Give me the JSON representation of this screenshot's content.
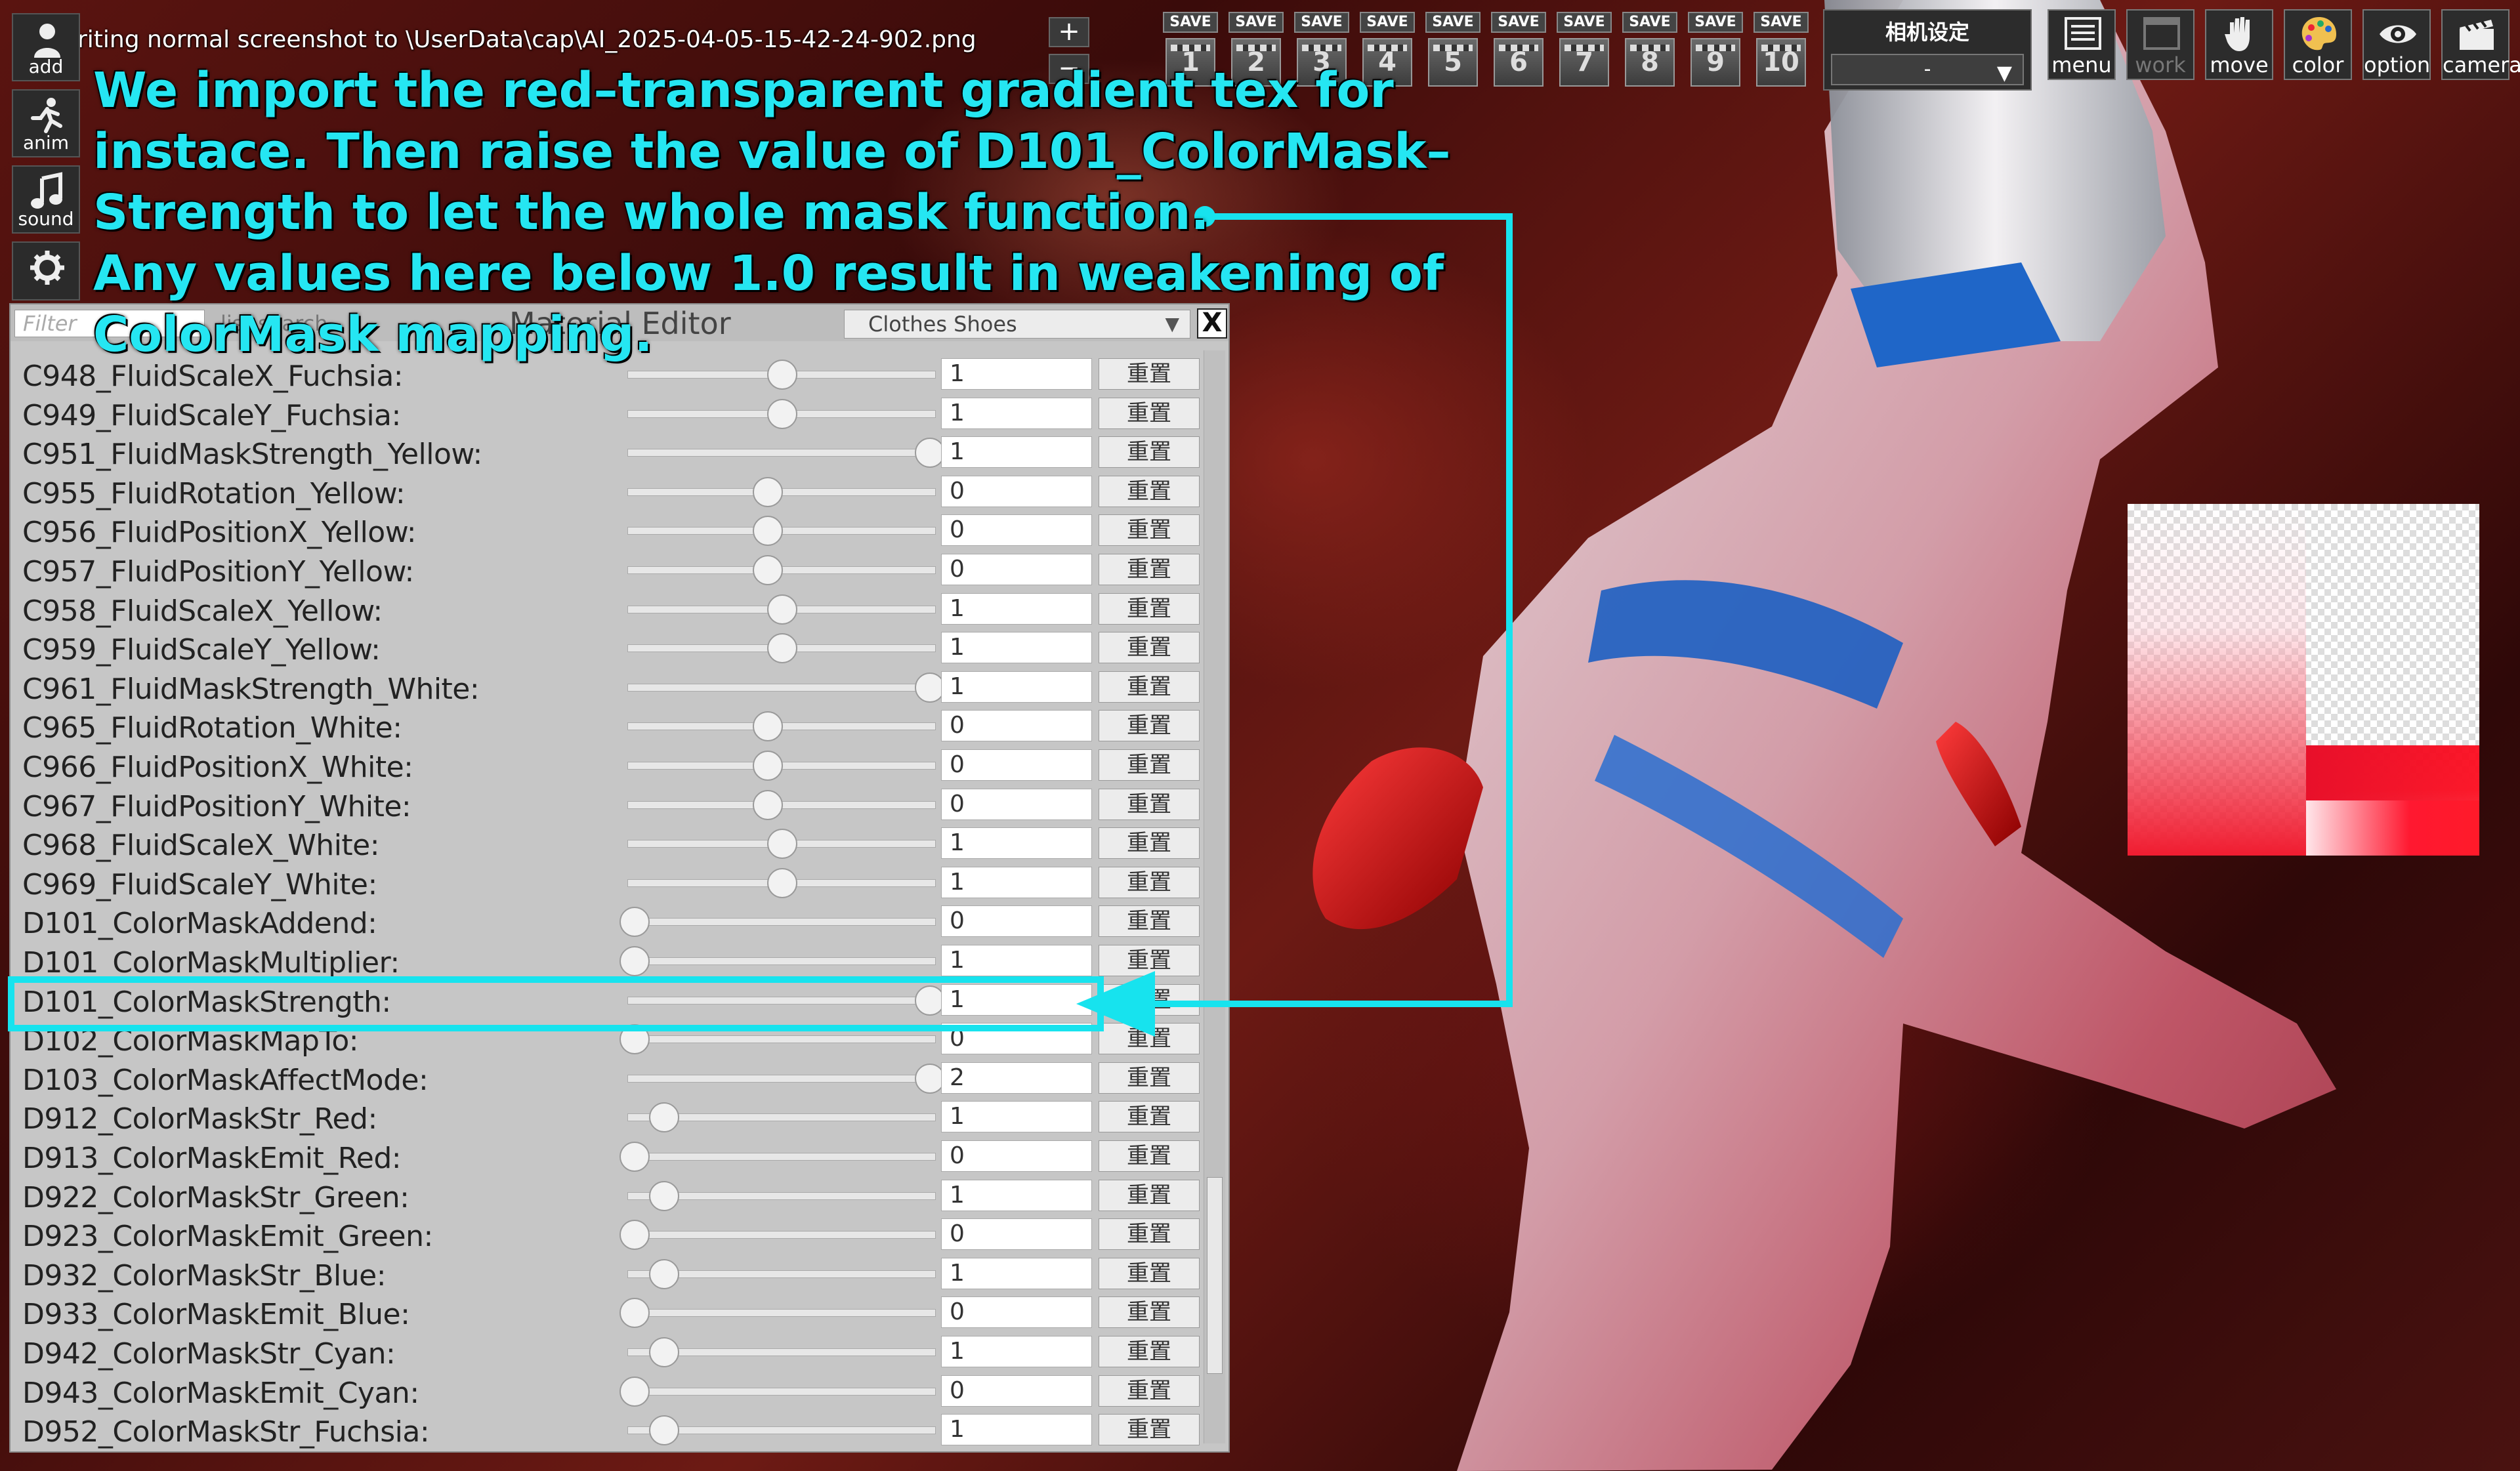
{
  "title_bar": "riting normal screenshot to \\UserData\\cap\\AI_2025-04-05-15-42-24-902.png",
  "side_buttons": [
    {
      "label": "add",
      "icon": "person-add-icon"
    },
    {
      "label": "anim",
      "icon": "running-figure-icon"
    },
    {
      "label": "sound",
      "icon": "music-note-icon"
    },
    {
      "label": "system",
      "icon": "gear-icon"
    }
  ],
  "mini_buttons": [
    "+",
    "−"
  ],
  "save_slots": {
    "save_label": "SAVE",
    "numbers": [
      "1",
      "2",
      "3",
      "4",
      "5",
      "6",
      "7",
      "8",
      "9",
      "10"
    ]
  },
  "camera_settings": {
    "title": "相机设定",
    "value": "-"
  },
  "tool_buttons": [
    {
      "label": "menu",
      "icon": "menu-list-icon"
    },
    {
      "label": "work",
      "icon": "work-window-icon"
    },
    {
      "label": "move",
      "icon": "hand-icon"
    },
    {
      "label": "color",
      "icon": "palette-icon"
    },
    {
      "label": "option",
      "icon": "eye-icon"
    },
    {
      "label": "camera",
      "icon": "clapperboard-icon"
    }
  ],
  "editor": {
    "filter_placeholder": "Filter",
    "list_search": "list search",
    "title": "Material Editor",
    "category": "Clothes Shoes",
    "close": "X",
    "reset_label": "重置",
    "rows": [
      {
        "name": "C948_FluidScaleX_Fuchsia:",
        "value": "1",
        "slider": 0.5
      },
      {
        "name": "C949_FluidScaleY_Fuchsia:",
        "value": "1",
        "slider": 0.5
      },
      {
        "name": "C951_FluidMaskStrength_Yellow:",
        "value": "1",
        "slider": 1.0
      },
      {
        "name": "C955_FluidRotation_Yellow:",
        "value": "0",
        "slider": 0.45
      },
      {
        "name": "C956_FluidPositionX_Yellow:",
        "value": "0",
        "slider": 0.45
      },
      {
        "name": "C957_FluidPositionY_Yellow:",
        "value": "0",
        "slider": 0.45
      },
      {
        "name": "C958_FluidScaleX_Yellow:",
        "value": "1",
        "slider": 0.5
      },
      {
        "name": "C959_FluidScaleY_Yellow:",
        "value": "1",
        "slider": 0.5
      },
      {
        "name": "C961_FluidMaskStrength_White:",
        "value": "1",
        "slider": 1.0
      },
      {
        "name": "C965_FluidRotation_White:",
        "value": "0",
        "slider": 0.45
      },
      {
        "name": "C966_FluidPositionX_White:",
        "value": "0",
        "slider": 0.45
      },
      {
        "name": "C967_FluidPositionY_White:",
        "value": "0",
        "slider": 0.45
      },
      {
        "name": "C968_FluidScaleX_White:",
        "value": "1",
        "slider": 0.5
      },
      {
        "name": "C969_FluidScaleY_White:",
        "value": "1",
        "slider": 0.5
      },
      {
        "name": "D101_ColorMaskAddend:",
        "value": "0",
        "slider": 0.0
      },
      {
        "name": "D101_ColorMaskMultiplier:",
        "value": "1",
        "slider": 0.0
      },
      {
        "name": "D101_ColorMaskStrength:",
        "value": "1",
        "slider": 1.0
      },
      {
        "name": "D102_ColorMaskMapTo:",
        "value": "0",
        "slider": 0.0
      },
      {
        "name": "D103_ColorMaskAffectMode:",
        "value": "2",
        "slider": 1.0
      },
      {
        "name": "D912_ColorMaskStr_Red:",
        "value": "1",
        "slider": 0.1
      },
      {
        "name": "D913_ColorMaskEmit_Red:",
        "value": "0",
        "slider": 0.0
      },
      {
        "name": "D922_ColorMaskStr_Green:",
        "value": "1",
        "slider": 0.1
      },
      {
        "name": "D923_ColorMaskEmit_Green:",
        "value": "0",
        "slider": 0.0
      },
      {
        "name": "D932_ColorMaskStr_Blue:",
        "value": "1",
        "slider": 0.1
      },
      {
        "name": "D933_ColorMaskEmit_Blue:",
        "value": "0",
        "slider": 0.0
      },
      {
        "name": "D942_ColorMaskStr_Cyan:",
        "value": "1",
        "slider": 0.1
      },
      {
        "name": "D943_ColorMaskEmit_Cyan:",
        "value": "0",
        "slider": 0.0
      },
      {
        "name": "D952_ColorMaskStr_Fuchsia:",
        "value": "1",
        "slider": 0.1
      }
    ]
  },
  "annotation": {
    "lines": [
      "We import the red–transparent gradient tex for",
      "instace. Then raise the value of D101_ColorMask–",
      "Strength to let the whole mask function.",
      "Any values here below 1.0 result in weakening of",
      "ColorMask mapping."
    ],
    "color": "#25e6f2"
  }
}
